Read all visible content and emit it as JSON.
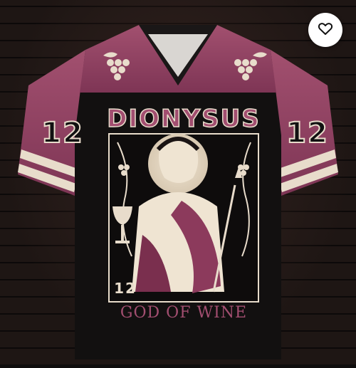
{
  "product": {
    "title": "DIONYSUS",
    "subtitle": "GOD OF WINE",
    "sleeve_number_left": "12",
    "sleeve_number_right": "12",
    "chest_number": "12"
  },
  "favorite_button": {
    "icon": "heart-icon"
  },
  "colors": {
    "jersey_mauve": "#9a4a6a",
    "jersey_black": "#111010",
    "cream": "#e8dccb",
    "accent_wine": "#8c3a5c"
  }
}
